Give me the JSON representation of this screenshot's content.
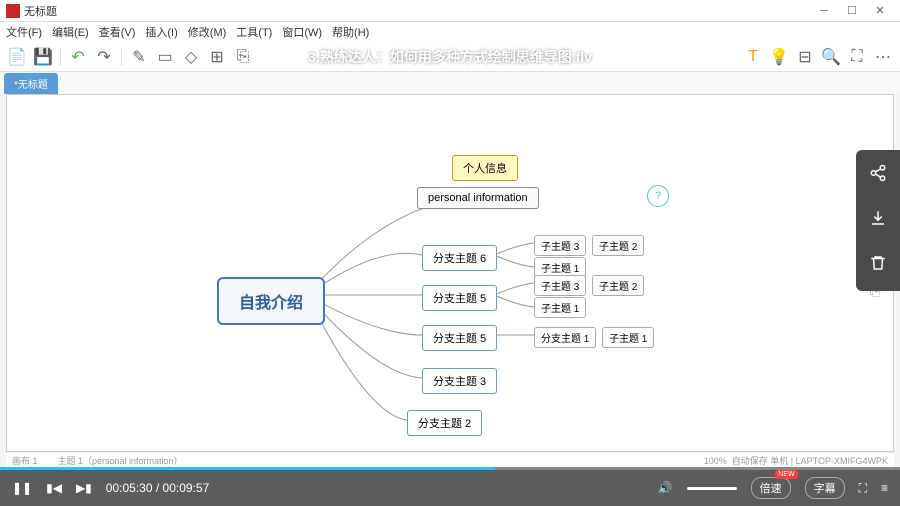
{
  "titlebar": {
    "app": "无标题"
  },
  "menus": [
    "文件(F)",
    "编辑(E)",
    "查看(V)",
    "插入(I)",
    "修改(M)",
    "工具(T)",
    "窗口(W)",
    "帮助(H)"
  ],
  "video_title": "3.熟练达人：如何用多种方式绘制思维导图.flv",
  "tab": "*无标题",
  "mindmap": {
    "root": "自我介绍",
    "top_yellow": "个人信息",
    "top_info": "personal information",
    "branch6": "分支主题 6",
    "branch5a": "分支主题 5",
    "branch5b": "分支主题 5",
    "branch3": "分支主题 3",
    "branch2": "分支主题 2",
    "sub_z3": "子主题 3",
    "sub_z2": "子主题 2",
    "sub_z1": "子主题 1",
    "sub_z3b": "子主题 3",
    "sub_z2b": "子主题 2",
    "sub_z1b": "子主题 1",
    "sub_f1": "分支主题 1",
    "sub_zm1": "子主题 1"
  },
  "player": {
    "current": "00:05:30",
    "total": "00:09:57",
    "speed": "倍速",
    "subtitle": "字幕",
    "newtag": "NEW"
  },
  "status": {
    "left": "主题 1（personal information）",
    "right": "自动保存  单机  | LAPTOP-XMIFG4WPK",
    "zoom": "100%",
    "sheet": "画布 1"
  }
}
